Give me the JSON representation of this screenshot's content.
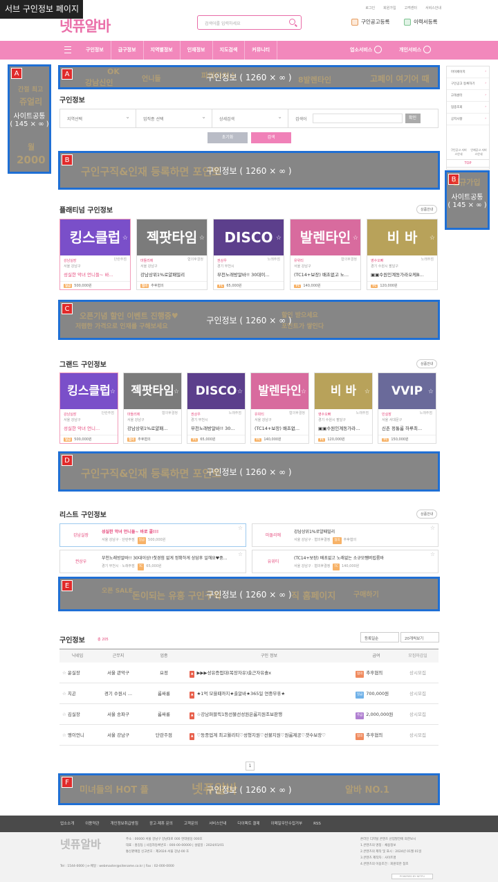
{
  "page_tag": "서브 구인정보 페이지",
  "top_links": [
    "로그인",
    "회원가입",
    "고객센터",
    "서비스안내"
  ],
  "logo": "넷퓨알바",
  "search": {
    "placeholder": "검색어를 입력하세요"
  },
  "header_buttons": [
    "구인공고등록",
    "이력서등록"
  ],
  "nav": {
    "items": [
      "구인정보",
      "급구정보",
      "지역별정보",
      "인재정보",
      "지도검색",
      "커뮤니티"
    ],
    "right": [
      "업소서비스",
      "개인서비스"
    ]
  },
  "banners": {
    "A_left": {
      "letter": "A",
      "label": "사이트공통",
      "size": "( 145 × ∞ )",
      "bg": [
        "간절 최고",
        "쥬얼리",
        "월",
        "2000"
      ]
    },
    "A_top": {
      "letter": "A",
      "label": "구인정보 ( 1260 × ∞ )",
      "bg": [
        "OK",
        "강남신인",
        "언니들",
        "파라다이스",
        "8발렌타인",
        "고페이 여기어 때"
      ]
    },
    "B": {
      "letter": "B",
      "label": "구인정보 ( 1260 × ∞ )",
      "bg": "구인구직&인재 등록하면 포인트"
    },
    "B_right": {
      "letter": "B",
      "label": "사이트공통",
      "size": "( 145 × ∞ )",
      "bg": "신규가입"
    },
    "C": {
      "letter": "C",
      "label": "구인정보 ( 1260 × ∞ )",
      "bg": [
        "오픈기념 할인 이벤트 진행중♥",
        "저렴한 가격으로 인재를 구해보세요",
        "할인 받으세요",
        "포인트가 쌓인다"
      ]
    },
    "D": {
      "letter": "D",
      "label": "구인정보 ( 1260 × ∞ )",
      "bg": "구인구직&인재 등록하면 포인트"
    },
    "E": {
      "letter": "E",
      "label": "구인정보 ( 1260 × ∞ )",
      "bg": [
        "오픈 SALE",
        "돈이되는 유흥 구인구직",
        "직 홈페이지",
        "구매하기"
      ]
    },
    "F": {
      "letter": "F",
      "label": "구인정보 ( 1260 × ∞ )",
      "bg": [
        "미녀들의 HOT 플",
        "넷퓨알바",
        "알바 NO.1"
      ]
    }
  },
  "search_title": "구인정보",
  "filters": [
    "지역선택",
    "업직종 선택",
    "상세검색"
  ],
  "keyword_label": "검색어",
  "confirm": "확인",
  "reset": "초기화",
  "do_search": "검색",
  "more": "상품안내",
  "platinum": {
    "title": "플래티넘 구인정보",
    "cards": [
      {
        "img": "킹스클럽",
        "co": "강남실장",
        "sig": "단란주점",
        "loc": "서울 강남구",
        "title": "성실한 악녀 언니들~ 바...",
        "pay_type": "일급",
        "pay": "500,000원",
        "color": "#7a4fc9"
      },
      {
        "img": "젝팟타임",
        "co": "마돌리에",
        "sig": "협의후결정",
        "loc": "서울 강남구",
        "title": "강남상위1%로얄패밀리",
        "pay_type": "협의",
        "pay": "추후협의",
        "color": "#7b7b7b"
      },
      {
        "img": "DISCO",
        "co": "권상우",
        "sig": "노래주점",
        "loc": "경기 부천시",
        "title": "부천노래방알바!! 30대이...",
        "pay_type": "TC",
        "pay": "65,000원",
        "color": "#5c3f8c"
      },
      {
        "img": "발렌타인",
        "co": "유위티",
        "sig": "협의후결정",
        "loc": "서울 강남구",
        "title": "(TC14+보장) 배초없고 노...",
        "pay_type": "TC",
        "pay": "140,000원",
        "color": "#d86b9e"
      },
      {
        "img": "비 바",
        "co": "영수오빠",
        "sig": "노래주점",
        "loc": "경기 수원시 팔달구",
        "title": "▣▣수원인계동가라오케B...",
        "pay_type": "TC",
        "pay": "120,000원",
        "color": "#b8a25a"
      }
    ]
  },
  "grand": {
    "title": "그랜드 구인정보",
    "cards": [
      {
        "img": "킹스클럽",
        "co": "강남실장",
        "sig": "단란주점",
        "loc": "서울 강남구",
        "title": "성실한 악녀 언니...",
        "pay_type": "일급",
        "pay": "500,000원",
        "color": "#7a4fc9"
      },
      {
        "img": "젝팟타임",
        "co": "마돌리에",
        "sig": "협의후결정",
        "loc": "서울 강남구",
        "title": "강남상위1%로얄패...",
        "pay_type": "협의",
        "pay": "추후협의",
        "color": "#7b7b7b"
      },
      {
        "img": "DISCO",
        "co": "권상우",
        "sig": "노래주점",
        "loc": "경기 부천시",
        "title": "부천노래방알바!! 30...",
        "pay_type": "TC",
        "pay": "65,000원",
        "color": "#5c3f8c"
      },
      {
        "img": "발렌타인",
        "co": "유위티",
        "sig": "협의후결정",
        "loc": "서울 강남구",
        "title": "(TC14+보장) 배초없...",
        "pay_type": "TC",
        "pay": "140,000원",
        "color": "#d86b9e"
      },
      {
        "img": "비 바",
        "co": "영수오빠",
        "sig": "노래주점",
        "loc": "경기 수원시 팔달구",
        "title": "▣▣수원인계동가라...",
        "pay_type": "TC",
        "pay": "120,000원",
        "color": "#b8a25a"
      },
      {
        "img": "VVIP",
        "co": "민실장",
        "sig": "노래주점",
        "loc": "서울 서대문구",
        "title": "신촌 정통룸 하루최...",
        "pay_type": "TC",
        "pay": "150,000원",
        "color": "#6a6a9a"
      }
    ]
  },
  "listinfo": {
    "title": "리스트 구인정보",
    "items": [
      {
        "co": "강남실장",
        "title": "성실한 악녀 언니들~ 바로 콜!!!",
        "meta": "서울 강남구 · 단란주점",
        "pay_type": "일급",
        "pay": "500,000원",
        "hl": true
      },
      {
        "co": "마돌리에",
        "title": "강남상위1%로얄패밀리",
        "meta": "서울 강남구 · 협의후결정",
        "pay_type": "협의",
        "pay": "추후협의",
        "hl": false
      },
      {
        "co": "권상우",
        "title": "부천노래방알바!! 30대이상!!첫경험 없게 정확하게 상담후 일해요♥중...",
        "meta": "경기 부천시 · 노래주점",
        "pay_type": "TC",
        "pay": "65,000원",
        "hl": false
      },
      {
        "co": "유위티",
        "title": "(TC14+보장) 배초없고 노래없는 소규모쨈버립룸바",
        "meta": "서울 강남구 · 협의후결정",
        "pay_type": "TC",
        "pay": "140,000원",
        "hl": false
      }
    ]
  },
  "joblist": {
    "title": "구인정보",
    "count": "총 205",
    "sort": "등록일순",
    "per_page": "20개씩보기",
    "headers": [
      "닉네임",
      "근무지",
      "업종",
      "구인 정보",
      "급여",
      "모집마감일"
    ],
    "rows": [
      {
        "nick": "윤실장",
        "loc": "서울 관악구",
        "type": "요정",
        "title": "▶▶▶성유증접대(복장자유)출근자유솔x",
        "pay_type": "협의",
        "pay": "추후협의",
        "end": "상시모집",
        "pc": "#f08a5d"
      },
      {
        "nick": "치곤",
        "loc": "경기 수원시 ...",
        "type": "룸싸롱",
        "title": "★1억 모을때까지★출알바★365일 연중무휴★",
        "pay_type": "일급",
        "pay": "700,000원",
        "end": "상시모집",
        "pc": "#6fb1e8"
      },
      {
        "nick": "김실장",
        "loc": "서울 송파구",
        "type": "룸싸롱",
        "title": "☆강남퍼블릭1등선불선성원은룸지원조보판행",
        "pay_type": "주급",
        "pay": "2,000,000원",
        "end": "상시모집",
        "pc": "#b07fd1"
      },
      {
        "nick": "엥이언니",
        "loc": "서울 강남구",
        "type": "단란주점",
        "title": "♡동종업계 최고월리티♡성형지원♡선불지원♡원룸제공♡갯수보장♡",
        "pay_type": "협의",
        "pay": "추후협의",
        "end": "상시모집",
        "pc": "#f08a5d"
      }
    ]
  },
  "page_num": "1",
  "footer": {
    "links": [
      "업소소개",
      "이용약관",
      "개인정보취급방침",
      "광고·제휴 문의",
      "고객문의",
      "서비스안내",
      "다이렉트 결제",
      "이메일무단수집거부",
      "RSS"
    ],
    "addr": [
      "주소 : 00000 서울 강남구 강남대로 000 현대빌딩 000호",
      "대표 : 홍길동 | 사업자등록번호 : 000-00-00000 | 설립일 : 2024/01/01",
      "통신판매업 신고번호 : 제2024-서울 강남-00 호"
    ],
    "contact": "Tel : 1544-0000 | e-메일 : webmaster@sitename.co.kr | Fax : 02-000-0000",
    "right": [
      "온라인 디지털 콘텐츠 산업발전에 의한보시",
      "1.콘텐츠의 명칭 : 채용정보",
      "2.콘텐츠의 제작 및 표시 : 2024년 01월 01일",
      "3.콘텐츠 제작자 : 사이트명",
      "4.콘텐츠의 이용조건 : 회원약관 참조"
    ],
    "badge": "POWERED BY NETFU"
  },
  "sidebar": [
    "마이페이지",
    "구인공고 등록하기",
    "고객센터",
    "업종조회",
    "공지사항"
  ],
  "sidebar_icons": [
    "구인공고 서비스안내",
    "인재공고 서비스안내"
  ],
  "top_button": "TOP"
}
